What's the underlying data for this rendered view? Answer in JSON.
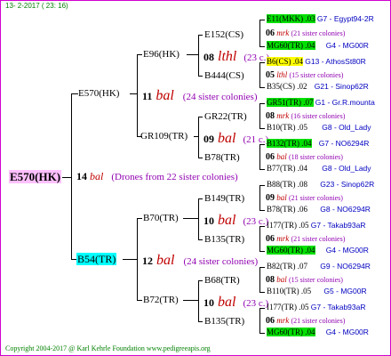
{
  "header": "13-  2-2017  ( 23: 16)",
  "footer": "Copyright 2004-2017 @ Karl Kehrle Foundation   www.pedigreeapis.org",
  "gen1": {
    "name": "E570(HK)",
    "year": "14",
    "bal": "bal",
    "sisters": "(Drones from 22 sister colonies)"
  },
  "gen2": [
    {
      "name": "E570(HK)",
      "year": "11",
      "bal": "bal",
      "sisters": "(24 sister colonies)"
    },
    {
      "name": "B54(TR)",
      "year": "12",
      "bal": "bal",
      "sisters": "(24 sister colonies)"
    }
  ],
  "gen3": [
    {
      "name": "E96(HK)",
      "year": "08",
      "bal": "lthl",
      "sisters": "(23 c.)"
    },
    {
      "name": "GR109(TR)",
      "year": "09",
      "bal": "bal",
      "sisters": "(21 c.)"
    },
    {
      "name": "B70(TR)",
      "year": "10",
      "bal": "bal",
      "sisters": "(23 c.)"
    },
    {
      "name": "B72(TR)",
      "year": "10",
      "bal": "bal",
      "sisters": "(23 c.)"
    }
  ],
  "gen4": [
    {
      "name": "E152(CS)",
      "year": "06",
      "bal": "mrk",
      "sisters": "(21 sister colonies)"
    },
    {
      "name": "B444(CS)",
      "year": "05",
      "bal": "lthl",
      "sisters": "(15 sister colonies)"
    },
    {
      "name": "GR22(TR)",
      "year": "08",
      "bal": "mrk",
      "sisters": "(16 sister colonies)"
    },
    {
      "name": "B78(TR)",
      "year": "06",
      "bal": "bal",
      "sisters": "(18 sister colonies)"
    },
    {
      "name": "B149(TR)",
      "year": "09",
      "bal": "bal",
      "sisters": "(21 sister colonies)"
    },
    {
      "name": "B135(TR)",
      "year": "06",
      "bal": "mrk",
      "sisters": "(21 sister colonies)"
    },
    {
      "name": "B68(TR)",
      "year": "08",
      "bal": "bal",
      "sisters": "(15 sister colonies)"
    },
    {
      "name": "B135(TR)",
      "year": "06",
      "bal": "mrk",
      "sisters": "(21 sister colonies)"
    }
  ],
  "gen5": [
    {
      "name": "E11(MKK) .03",
      "id": "G7 - Egypt94-2R"
    },
    {
      "name": "MG60(TR) .04",
      "id": "G4 - MG00R"
    },
    {
      "name": "B6(CS) .04",
      "id": "G13 - AthosSt80R"
    },
    {
      "name": "B35(CS) .02",
      "id": "G21 - Sinop62R"
    },
    {
      "name": "GR51(TR) .07",
      "id": "G1 - Gr.R.mounta"
    },
    {
      "name": "B10(TR) .05",
      "id": "G8 - Old_Lady"
    },
    {
      "name": "B132(TR) .04",
      "id": "G7 - NO6294R"
    },
    {
      "name": "B77(TR) .04",
      "id": "G8 - Old_Lady"
    },
    {
      "name": "B88(TR) .08",
      "id": "G23 - Sinop62R"
    },
    {
      "name": "B78(TR) .06",
      "id": "G8 - NO6294R"
    },
    {
      "name": "I177(TR) .05",
      "id": "G7 - Takab93aR"
    },
    {
      "name": "MG60(TR) .04",
      "id": "G4 - MG00R"
    },
    {
      "name": "B82(TR) .07",
      "id": "G9 - NO6294R"
    },
    {
      "name": "B110(TR) .05",
      "id": "G5 - MG00R"
    },
    {
      "name": "I177(TR) .05",
      "id": "G7 - Takab93aR"
    },
    {
      "name": "MG60(TR) .04",
      "id": "G4 - MG00R"
    }
  ]
}
